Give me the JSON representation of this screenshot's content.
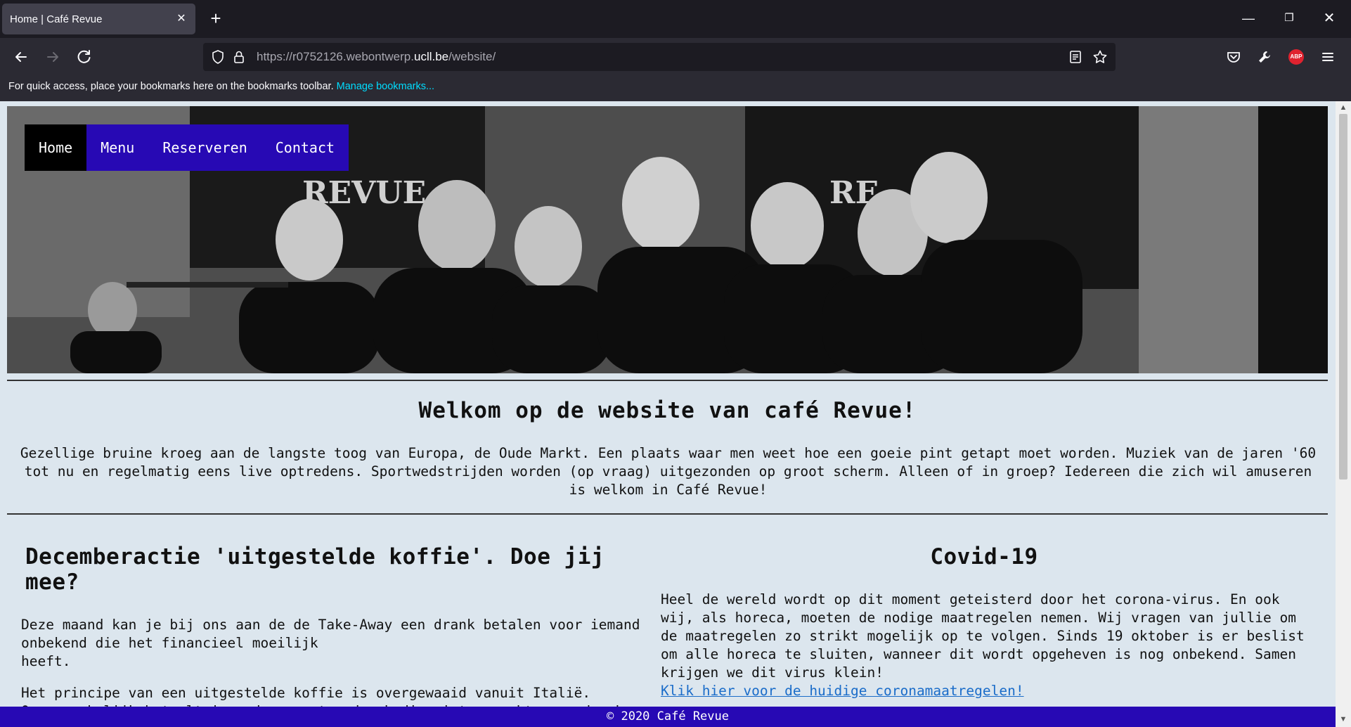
{
  "browser": {
    "tab_title": "Home | Café Revue",
    "url_prefix": "https://r0752126.webontwerp.",
    "url_domain": "ucll.be",
    "url_path": "/website/",
    "bookmarks_text": "For quick access, place your bookmarks here on the bookmarks toolbar.",
    "bookmarks_link": "Manage bookmarks...",
    "icons": [
      "back-arrow-icon",
      "forward-arrow-icon",
      "reload-icon",
      "shield-icon",
      "lock-icon",
      "reader-view-icon",
      "star-icon",
      "pocket-icon",
      "wrench-icon",
      "adblock-icon",
      "hamburger-menu-icon"
    ],
    "adblock_badge": "ABP"
  },
  "site": {
    "nav": [
      {
        "label": "Home",
        "active": true
      },
      {
        "label": "Menu",
        "active": false
      },
      {
        "label": "Reserveren",
        "active": false
      },
      {
        "label": "Contact",
        "active": false
      }
    ],
    "welcome_title": "Welkom op de website van café Revue!",
    "welcome_text": "Gezellige bruine kroeg aan de langste toog van Europa, de Oude Markt. Een plaats waar men weet hoe een goeie pint getapt moet worden. Muziek van de jaren '60 tot nu en regelmatig eens live optredens. Sportwedstrijden worden (op vraag) uitgezonden op groot scherm. Alleen of in groep? Iedereen die zich wil amuseren is welkom in Café Revue!",
    "left": {
      "title": "Decemberactie 'uitgestelde koffie'. Doe jij mee?",
      "p1_line1": "Deze maand kan je bij ons aan de de Take-Away een drank betalen voor iemand onbekend die het financieel moeilijk",
      "p1_line2": "heeft.",
      "p2": "Het principe van een uitgestelde koffie is overgewaaid vanuit Italië. Oorspronkelijk betaalt iemand een extra drank die niet gemaakt en gedronken wordt. De drank wordt op een kaartje genoteerd en"
    },
    "right": {
      "title": "Covid-19",
      "text": "Heel de wereld wordt op dit moment geteisterd door het corona-virus. En ook wij, als horeca, moeten de nodige maatregelen nemen. Wij vragen van jullie om de maatregelen zo strikt mogelijk op te volgen. Sinds 19 oktober is er beslist om alle horeca te sluiten, wanneer dit wordt opgeheven is nog onbekend. Samen krijgen we dit virus klein!",
      "link": "Klik hier voor de huidige coronamaatregelen!"
    },
    "footer": "© 2020 Café Revue",
    "colors": {
      "nav_bg": "#2709b4",
      "page_bg": "#dce6ee",
      "footer_bg": "#2709b4"
    }
  }
}
